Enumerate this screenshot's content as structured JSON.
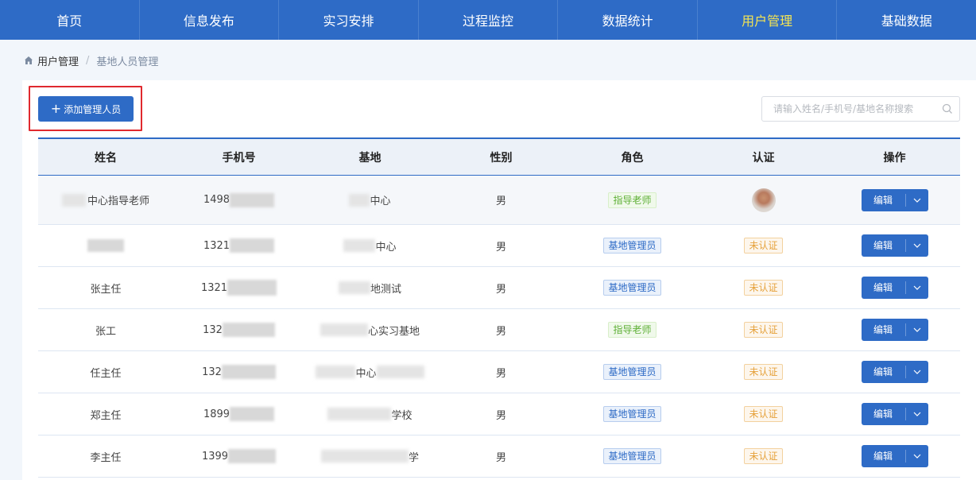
{
  "nav": {
    "items": [
      {
        "label": "首页"
      },
      {
        "label": "信息发布"
      },
      {
        "label": "实习安排"
      },
      {
        "label": "过程监控"
      },
      {
        "label": "数据统计"
      },
      {
        "label": "用户管理"
      },
      {
        "label": "基础数据"
      }
    ],
    "active_index": 5
  },
  "breadcrumb": {
    "items": [
      "用户管理",
      "基地人员管理"
    ],
    "separator": "/"
  },
  "toolbar": {
    "add_label": "添加管理人员",
    "search_placeholder": "请输入姓名/手机号/基地名称搜索"
  },
  "table": {
    "columns": [
      "姓名",
      "手机号",
      "基地",
      "性别",
      "角色",
      "认证",
      "操作"
    ],
    "rows": [
      {
        "name": "中心指导老师",
        "phone": "1498",
        "base": "中心",
        "gender": "男",
        "role": "指导老师",
        "role_type": "guide",
        "auth": "avatar",
        "action": "编辑"
      },
      {
        "name": "",
        "phone": "1321",
        "base": "中心",
        "gender": "男",
        "role": "基地管理员",
        "role_type": "admin",
        "auth": "未认证",
        "action": "编辑"
      },
      {
        "name": "张主任",
        "phone": "1321",
        "base": "地测试",
        "gender": "男",
        "role": "基地管理员",
        "role_type": "admin",
        "auth": "未认证",
        "action": "编辑"
      },
      {
        "name": "张工",
        "phone": "132",
        "base": "心实习基地",
        "gender": "男",
        "role": "指导老师",
        "role_type": "guide",
        "auth": "未认证",
        "action": "编辑"
      },
      {
        "name": "任主任",
        "phone": "132",
        "base": "中心",
        "gender": "男",
        "role": "基地管理员",
        "role_type": "admin",
        "auth": "未认证",
        "action": "编辑"
      },
      {
        "name": "郑主任",
        "phone": "1899",
        "base": "学校",
        "gender": "男",
        "role": "基地管理员",
        "role_type": "admin",
        "auth": "未认证",
        "action": "编辑"
      },
      {
        "name": "李主任",
        "phone": "1399",
        "base": "学",
        "gender": "男",
        "role": "基地管理员",
        "role_type": "admin",
        "auth": "未认证",
        "action": "编辑"
      }
    ]
  },
  "colors": {
    "primary": "#2e6bc6",
    "nav_active": "#f5e552",
    "highlight": "#e0292e"
  }
}
